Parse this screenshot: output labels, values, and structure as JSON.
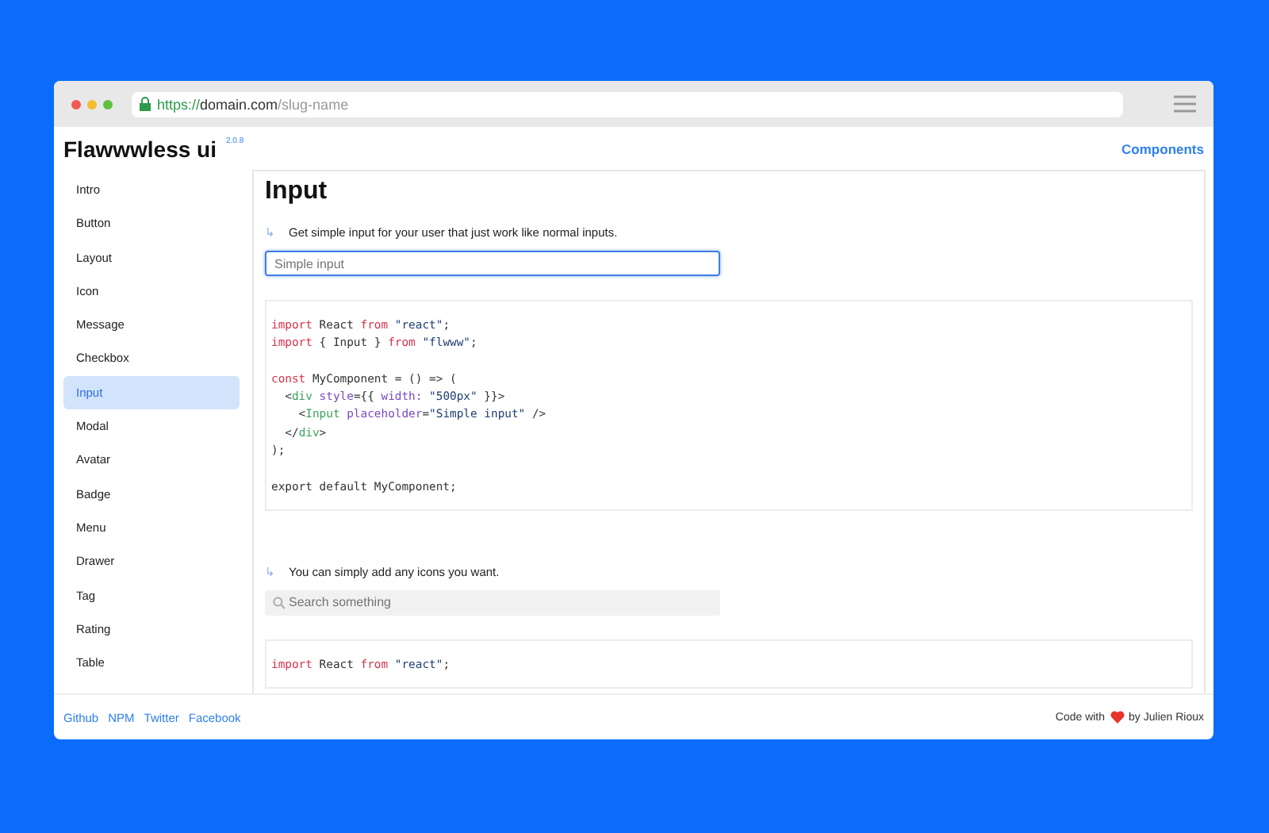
{
  "browser": {
    "url": [
      {
        "kind": "scheme",
        "text": "https://"
      },
      {
        "kind": "host",
        "text": "domain.com"
      },
      {
        "kind": "path",
        "text": "/slug-name"
      }
    ]
  },
  "header": {
    "title": "Flawwwless ui",
    "version": "2.0.8",
    "link": "Components"
  },
  "sidebar": {
    "items": [
      {
        "label": "Intro",
        "selected": false
      },
      {
        "label": "Button",
        "selected": false
      },
      {
        "label": "Layout",
        "selected": false
      },
      {
        "label": "Icon",
        "selected": false
      },
      {
        "label": "Message",
        "selected": false
      },
      {
        "label": "Checkbox",
        "selected": false
      },
      {
        "label": "Input",
        "selected": true
      },
      {
        "label": "Modal",
        "selected": false
      },
      {
        "label": "Avatar",
        "selected": false
      },
      {
        "label": "Badge",
        "selected": false
      },
      {
        "label": "Menu",
        "selected": false
      },
      {
        "label": "Drawer",
        "selected": false
      },
      {
        "label": "Tag",
        "selected": false
      },
      {
        "label": "Rating",
        "selected": false
      },
      {
        "label": "Table",
        "selected": false
      }
    ]
  },
  "main": {
    "title": "Input",
    "sections": [
      {
        "arrow": "↳",
        "text": "Get simple input for your user that just work like normal inputs.",
        "field": {
          "kind": "plain",
          "placeholder": "Simple input",
          "focused": true
        },
        "code": [
          {
            "gap_before": false,
            "tokens": [
              {
                "kind": "keyword",
                "text": "import"
              },
              {
                "kind": "plain",
                "text": " React "
              },
              {
                "kind": "keyword",
                "text": "from"
              },
              {
                "kind": "string",
                "text": " \"react\""
              },
              {
                "kind": "plain",
                "text": ";"
              }
            ]
          },
          {
            "gap_before": false,
            "tokens": [
              {
                "kind": "keyword",
                "text": "import"
              },
              {
                "kind": "plain",
                "text": " { Input } "
              },
              {
                "kind": "keyword",
                "text": "from"
              },
              {
                "kind": "string",
                "text": " \"flwww\""
              },
              {
                "kind": "plain",
                "text": ";"
              }
            ]
          },
          {
            "gap_before": true,
            "tokens": [
              {
                "kind": "keyword",
                "text": "const"
              },
              {
                "kind": "plain",
                "text": " MyComponent = () => ("
              }
            ]
          },
          {
            "gap_before": false,
            "tokens": [
              {
                "kind": "plain",
                "text": "  <"
              },
              {
                "kind": "tag",
                "text": "div"
              },
              {
                "kind": "attr",
                "text": " style"
              },
              {
                "kind": "plain",
                "text": "={{ "
              },
              {
                "kind": "attr",
                "text": "width:"
              },
              {
                "kind": "string",
                "text": " \"500px\""
              },
              {
                "kind": "plain",
                "text": " }}>"
              }
            ]
          },
          {
            "gap_before": false,
            "tokens": [
              {
                "kind": "plain",
                "text": "    <"
              },
              {
                "kind": "tag",
                "text": "Input"
              },
              {
                "kind": "attr",
                "text": " placeholder"
              },
              {
                "kind": "plain",
                "text": "="
              },
              {
                "kind": "string",
                "text": "\"Simple input\""
              },
              {
                "kind": "plain",
                "text": " />"
              }
            ]
          },
          {
            "gap_before": false,
            "tokens": [
              {
                "kind": "plain",
                "text": "  </"
              },
              {
                "kind": "tag",
                "text": "div"
              },
              {
                "kind": "plain",
                "text": ">"
              }
            ]
          },
          {
            "gap_before": false,
            "tokens": [
              {
                "kind": "plain",
                "text": ");"
              }
            ]
          },
          {
            "gap_before": true,
            "tokens": [
              {
                "kind": "plain",
                "text": "export default MyComponent;"
              }
            ]
          }
        ]
      },
      {
        "arrow": "↳",
        "text": "You can simply add any icons you want.",
        "field": {
          "kind": "search",
          "placeholder": "Search something",
          "focused": false
        },
        "code": [
          {
            "gap_before": false,
            "tokens": [
              {
                "kind": "keyword",
                "text": "import"
              },
              {
                "kind": "plain",
                "text": " React "
              },
              {
                "kind": "keyword",
                "text": "from"
              },
              {
                "kind": "string",
                "text": " \"react\""
              },
              {
                "kind": "plain",
                "text": ";"
              }
            ]
          }
        ]
      }
    ]
  },
  "footer": {
    "links": [
      "Github",
      "NPM",
      "Twitter",
      "Facebook"
    ],
    "credit_before": "Code with",
    "credit_after": "by Julien Rioux"
  }
}
